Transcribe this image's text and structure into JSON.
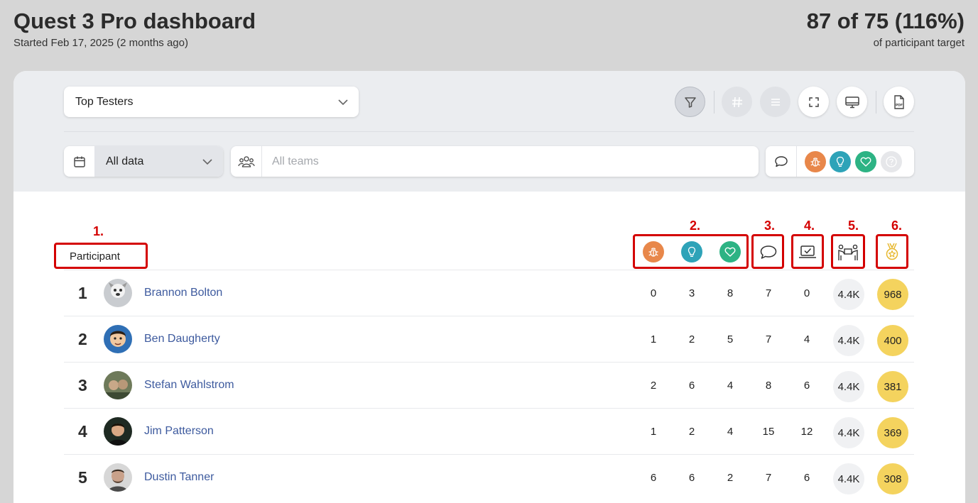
{
  "header": {
    "title": "Quest 3 Pro dashboard",
    "started": "Started Feb 17, 2025 (2 months ago)",
    "count": "87 of 75 (116%)",
    "count_sub": "of participant target"
  },
  "toolbar": {
    "view_select": "Top Testers",
    "buttons": [
      "filter-icon",
      "hashtag-icon",
      "list-icon",
      "fullscreen-icon",
      "monitor-icon",
      "pdf-icon"
    ]
  },
  "filters": {
    "date": "All data",
    "teams_placeholder": "All teams",
    "types": [
      "comment-icon",
      "bug-icon",
      "idea-icon",
      "praise-icon",
      "question-icon"
    ]
  },
  "colors": {
    "bug": "#e8874a",
    "idea": "#2ea3b8",
    "praise": "#2db384",
    "question": "#e6e7ea",
    "score": "#f4d35e",
    "annotation": "#d40000"
  },
  "annotations": [
    "1.",
    "2.",
    "3.",
    "4.",
    "5.",
    "6."
  ],
  "table": {
    "participant_header": "Participant",
    "rows": [
      {
        "rank": "1",
        "name": "Brannon Bolton",
        "bugs": "0",
        "ideas": "3",
        "praise": "8",
        "comments": "7",
        "tasks": "0",
        "activity": "4.4K",
        "score": "968"
      },
      {
        "rank": "2",
        "name": "Ben Daugherty",
        "bugs": "1",
        "ideas": "2",
        "praise": "5",
        "comments": "7",
        "tasks": "4",
        "activity": "4.4K",
        "score": "400"
      },
      {
        "rank": "3",
        "name": "Stefan Wahlstrom",
        "bugs": "2",
        "ideas": "6",
        "praise": "4",
        "comments": "8",
        "tasks": "6",
        "activity": "4.4K",
        "score": "381"
      },
      {
        "rank": "4",
        "name": "Jim Patterson",
        "bugs": "1",
        "ideas": "2",
        "praise": "4",
        "comments": "15",
        "tasks": "12",
        "activity": "4.4K",
        "score": "369"
      },
      {
        "rank": "5",
        "name": "Dustin Tanner",
        "bugs": "6",
        "ideas": "6",
        "praise": "2",
        "comments": "7",
        "tasks": "6",
        "activity": "4.4K",
        "score": "308"
      }
    ]
  }
}
